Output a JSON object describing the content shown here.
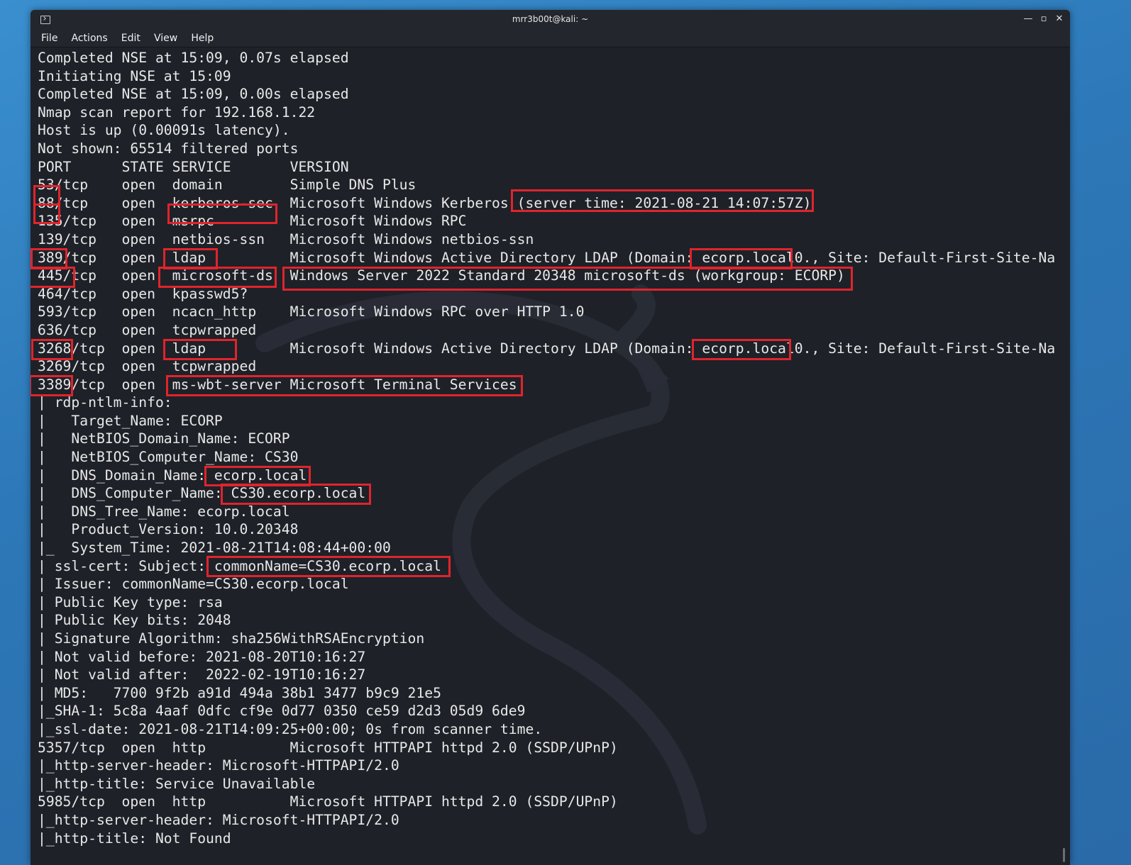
{
  "window": {
    "title": "mrr3b00t@kali: ~",
    "minimize_glyph": "—",
    "maximize_glyph": "▫",
    "close_glyph": "✕"
  },
  "menu": [
    "File",
    "Actions",
    "Edit",
    "View",
    "Help"
  ],
  "terminal": {
    "lines": [
      "Completed NSE at 15:09, 0.07s elapsed",
      "Initiating NSE at 15:09",
      "Completed NSE at 15:09, 0.00s elapsed",
      "Nmap scan report for 192.168.1.22",
      "Host is up (0.00091s latency).",
      "Not shown: 65514 filtered ports",
      "PORT      STATE SERVICE       VERSION",
      "53/tcp    open  domain        Simple DNS Plus",
      "88/tcp    open  kerberos-sec  Microsoft Windows Kerberos (server time: 2021-08-21 14:07:57Z)",
      "135/tcp   open  msrpc         Microsoft Windows RPC",
      "139/tcp   open  netbios-ssn   Microsoft Windows netbios-ssn",
      "389/tcp   open  ldap          Microsoft Windows Active Directory LDAP (Domain: ecorp.local0., Site: Default-First-Site-Na",
      "445/tcp   open  microsoft-ds  Windows Server 2022 Standard 20348 microsoft-ds (workgroup: ECORP)",
      "464/tcp   open  kpasswd5?",
      "593/tcp   open  ncacn_http    Microsoft Windows RPC over HTTP 1.0",
      "636/tcp   open  tcpwrapped",
      "3268/tcp  open  ldap          Microsoft Windows Active Directory LDAP (Domain: ecorp.local0., Site: Default-First-Site-Na",
      "3269/tcp  open  tcpwrapped",
      "3389/tcp  open  ms-wbt-server Microsoft Terminal Services",
      "| rdp-ntlm-info:",
      "|   Target_Name: ECORP",
      "|   NetBIOS_Domain_Name: ECORP",
      "|   NetBIOS_Computer_Name: CS30",
      "|   DNS_Domain_Name: ecorp.local",
      "|   DNS_Computer_Name: CS30.ecorp.local",
      "|   DNS_Tree_Name: ecorp.local",
      "|   Product_Version: 10.0.20348",
      "|_  System_Time: 2021-08-21T14:08:44+00:00",
      "| ssl-cert: Subject: commonName=CS30.ecorp.local",
      "| Issuer: commonName=CS30.ecorp.local",
      "| Public Key type: rsa",
      "| Public Key bits: 2048",
      "| Signature Algorithm: sha256WithRSAEncryption",
      "| Not valid before: 2021-08-20T10:16:27",
      "| Not valid after:  2022-02-19T10:16:27",
      "| MD5:   7700 9f2b a91d 494a 38b1 3477 b9c9 21e5",
      "|_SHA-1: 5c8a 4aaf 0dfc cf9e 0d77 0350 ce59 d2d3 05d9 6de9",
      "|_ssl-date: 2021-08-21T14:09:25+00:00; 0s from scanner time.",
      "5357/tcp  open  http          Microsoft HTTPAPI httpd 2.0 (SSDP/UPnP)",
      "|_http-server-header: Microsoft-HTTPAPI/2.0",
      "|_http-title: Service Unavailable",
      "5985/tcp  open  http          Microsoft HTTPAPI httpd 2.0 (SSDP/UPnP)",
      "|_http-server-header: Microsoft-HTTPAPI/2.0",
      "|_http-title: Not Found"
    ]
  },
  "colors": {
    "terminal_bg": "#1e2128",
    "text": "#e8e8e8",
    "highlight_box": "#e0242c",
    "desktop": "#2d78b8"
  }
}
